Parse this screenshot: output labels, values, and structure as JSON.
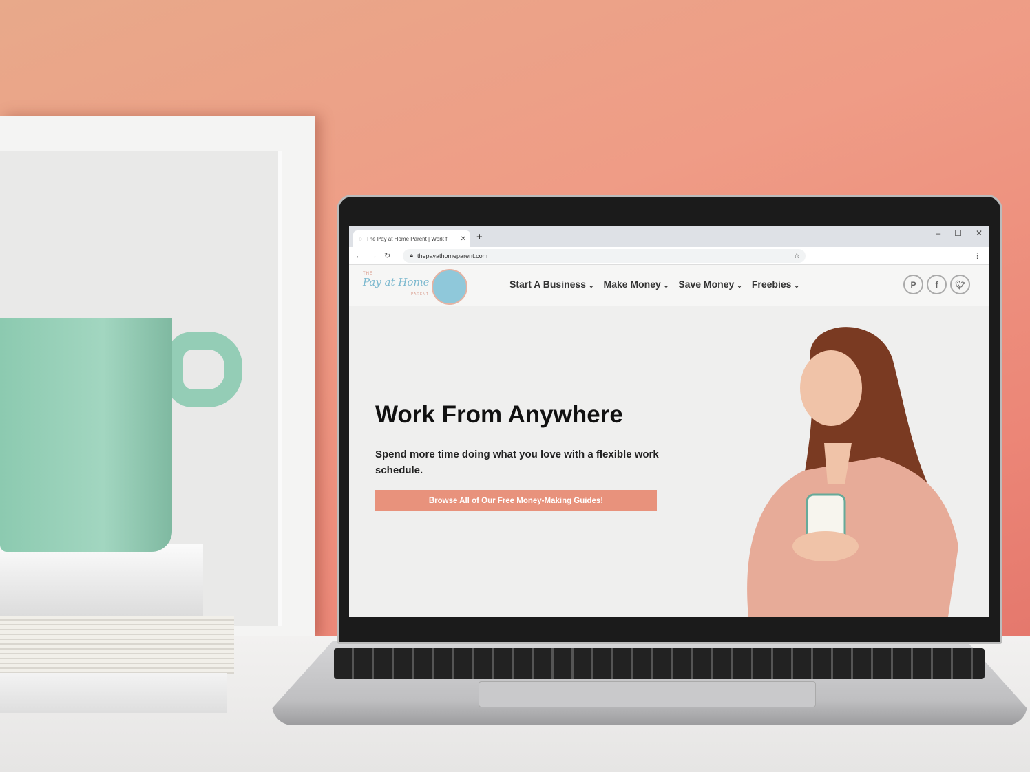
{
  "browser": {
    "tab_title": "The Pay at Home Parent | Work f",
    "new_tab": "+",
    "url": "thepayathomeparent.com",
    "window_controls": [
      "–",
      "☐",
      "✕"
    ]
  },
  "site": {
    "logo": {
      "the": "THE",
      "name": "Pay at Home",
      "parent": "PARENT"
    },
    "nav": [
      {
        "label": "Start A Business"
      },
      {
        "label": "Make Money"
      },
      {
        "label": "Save Money"
      },
      {
        "label": "Freebies"
      }
    ],
    "social": [
      "pinterest-icon",
      "facebook-icon",
      "twitter-icon"
    ],
    "hero": {
      "title": "Work From Anywhere",
      "subtitle": "Spend more time doing what you love with a flexible work schedule.",
      "cta": "Browse All of Our Free Money-Making Guides!"
    },
    "colors": {
      "accent": "#e8927c",
      "logo_blue": "#7db9cf",
      "background": "#efefee"
    }
  }
}
